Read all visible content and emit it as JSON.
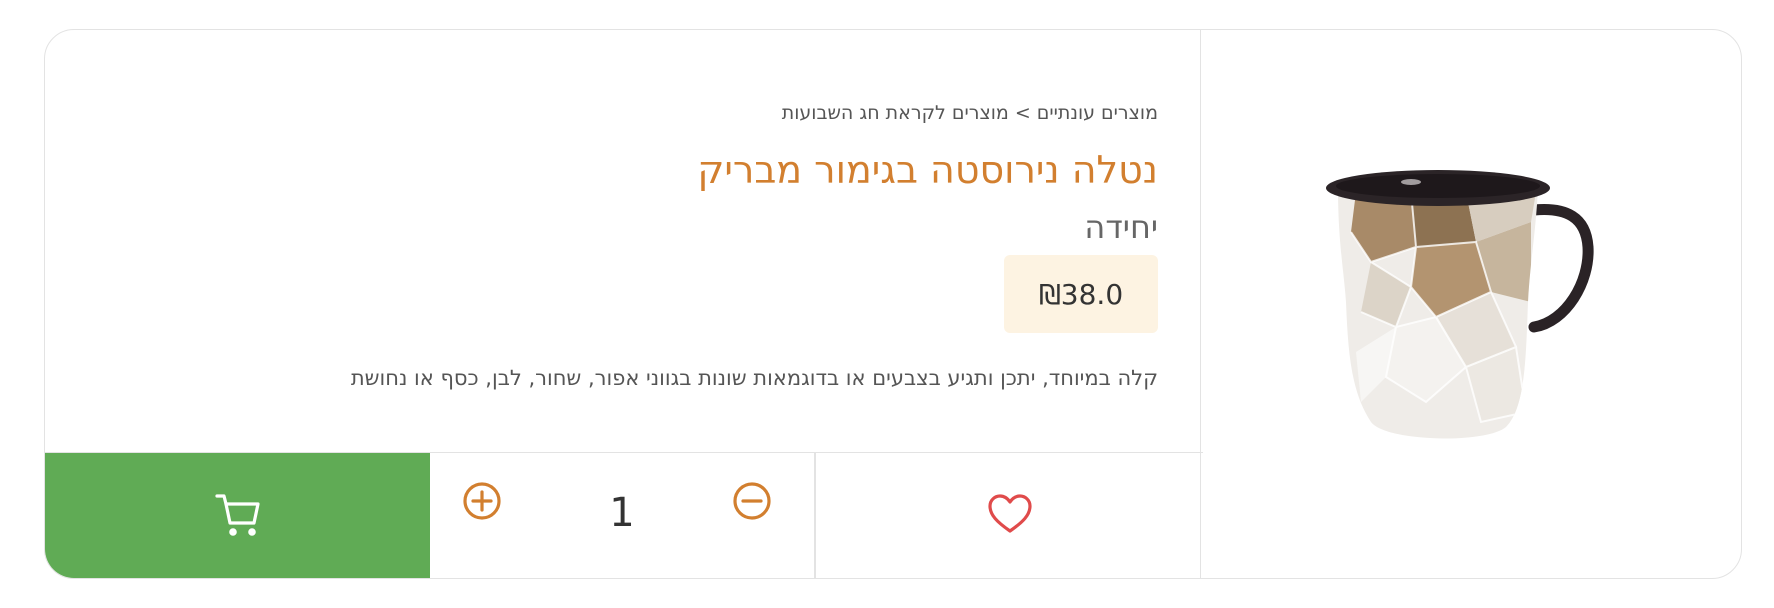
{
  "product": {
    "breadcrumb": {
      "category": "מוצרים עונתיים",
      "separator": ">",
      "subcategory": "מוצרים לקראת חג השבועות"
    },
    "title": "נטלה נירוסטה בגימור מבריק",
    "unit": "יחידה",
    "price": "₪38.0",
    "description": "קלה במיוחד, יתכן ותגיע בצבעים או בדוגמאות שונות בגווני אפור, שחור, לבן, כסף או נחושת",
    "image_icon": "washing-cup-image"
  },
  "actions": {
    "quantity": "1",
    "cart_icon": "cart-icon",
    "plus_icon": "plus-circle-icon",
    "minus_icon": "minus-circle-icon",
    "wishlist_icon": "heart-icon"
  },
  "colors": {
    "accent": "#d27f2f",
    "cart_bg": "#60ab55",
    "price_bg": "#fdf3e2",
    "heart": "#e04b4b",
    "border": "#e3e3e3"
  }
}
